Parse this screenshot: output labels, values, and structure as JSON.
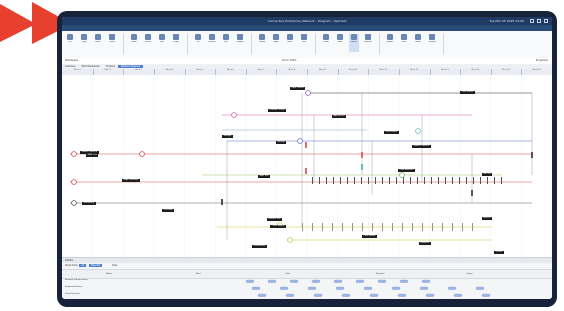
{
  "app": {
    "title": "Connected_Enterprise_Network - Diagram - Xpertaid",
    "right_info": "Tue Mar 25 2025 12:00",
    "menu": [
      "File",
      "Home",
      "Insert",
      "Design",
      "View",
      "Diagram",
      "Layout",
      "Review",
      "Help"
    ],
    "active_menu": "Diagram"
  },
  "ribbon": {
    "buttons": [
      "Cut",
      "Copy",
      "Paste",
      "Undo",
      "Redo",
      "Select",
      "Pan",
      "Zoom",
      "Fit",
      "Connect",
      "Text",
      "Shapes",
      "Group",
      "Align",
      "Filter",
      "Find",
      "Show",
      "Hide",
      "Layers",
      "Refresh",
      "Export",
      "Print",
      "Share",
      "Options"
    ],
    "selected_index": 18
  },
  "toolbar2": {
    "left": "Workspace",
    "middle": "Zoom 100%",
    "right": "Properties"
  },
  "tabs": {
    "items": [
      "Overview",
      "Work Breakdown",
      "Timeline",
      "Network Diagram"
    ],
    "active": 3
  },
  "ruler": {
    "segments": [
      "Week 1",
      "Week 2",
      "Week 3",
      "Week 4",
      "Week 5",
      "Week 6",
      "Week 7",
      "Week 8",
      "Week 9",
      "Week 10",
      "Week 11",
      "Week 12",
      "Week 13",
      "Week 14",
      "Week 15",
      "Week 16"
    ]
  },
  "diagram": {
    "labels": [
      "Data Center",
      "Core Switch",
      "Firewall Cluster",
      "App Server",
      "Storage",
      "Backup",
      "DMZ Router",
      "Branch Office A",
      "Branch Office B",
      "WAN Link",
      "Edge Gateway",
      "Load Balancer",
      "Web Tier",
      "DB Tier",
      "Monitoring",
      "VPN Hub",
      "Remote Site",
      "Cloud Region",
      "Archive",
      "Endpoint",
      "Printer",
      "Phone System",
      "Access Point",
      "Core Router",
      "Distribution"
    ]
  },
  "bottom": {
    "header": "Details",
    "filter_label": "Show items",
    "filter_pills": [
      "All",
      "Selected"
    ],
    "view_label": "View",
    "col_headers": [
      "Name",
      "Start",
      "End",
      "Duration",
      "Owner"
    ],
    "rows": [
      "Network Infrastructure",
      "Endpoint Devices",
      "Cloud Services"
    ]
  }
}
